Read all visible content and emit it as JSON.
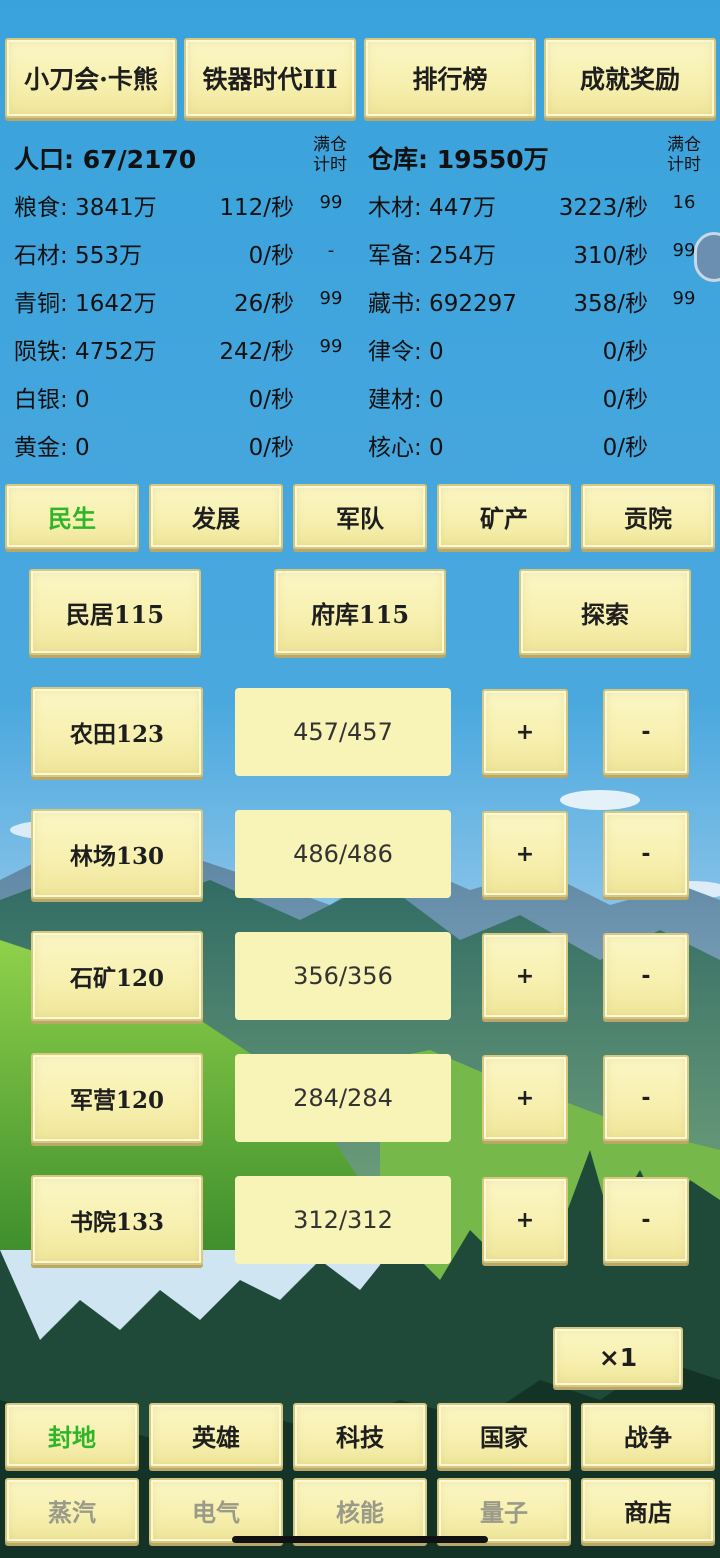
{
  "top_buttons": [
    "小刀会·卡熊",
    "铁器时代III",
    "排行榜",
    "成就奖励"
  ],
  "stats": {
    "population_label": "人口: 67/2170",
    "warehouse_label": "仓库: 19550万",
    "full_timer_label_left": "满仓\n计时",
    "full_timer_label_right": "满仓\n计时",
    "left": [
      {
        "name": "粮食: 3841万",
        "rate": "112/秒",
        "full": "99"
      },
      {
        "name": "石材: 553万",
        "rate": "0/秒",
        "full": "-"
      },
      {
        "name": "青铜: 1642万",
        "rate": "26/秒",
        "full": "99"
      },
      {
        "name": "陨铁: 4752万",
        "rate": "242/秒",
        "full": "99"
      },
      {
        "name": "白银: 0",
        "rate": "0/秒",
        "full": ""
      },
      {
        "name": "黄金: 0",
        "rate": "0/秒",
        "full": ""
      }
    ],
    "right": [
      {
        "name": "木材: 447万",
        "rate": "3223/秒",
        "full": "16"
      },
      {
        "name": "军备: 254万",
        "rate": "310/秒",
        "full": "99"
      },
      {
        "name": "藏书: 692297",
        "rate": "358/秒",
        "full": "99"
      },
      {
        "name": "律令: 0",
        "rate": "0/秒",
        "full": ""
      },
      {
        "name": "建材: 0",
        "rate": "0/秒",
        "full": ""
      },
      {
        "name": "核心: 0",
        "rate": "0/秒",
        "full": ""
      }
    ]
  },
  "tabs": [
    "民生",
    "发展",
    "军队",
    "矿产",
    "贡院"
  ],
  "buildings": [
    "民居115",
    "府库115",
    "探索"
  ],
  "workers": [
    {
      "name": "农田123",
      "count": "457/457"
    },
    {
      "name": "林场130",
      "count": "486/486"
    },
    {
      "name": "石矿120",
      "count": "356/356"
    },
    {
      "name": "军营120",
      "count": "284/284"
    },
    {
      "name": "书院133",
      "count": "312/312"
    }
  ],
  "plus_label": "+",
  "minus_label": "-",
  "speed_label": "×1",
  "nav_row1": [
    "封地",
    "英雄",
    "科技",
    "国家",
    "战争"
  ],
  "nav_row2": [
    "蒸汽",
    "电气",
    "核能",
    "量子",
    "商店"
  ],
  "colors": {
    "active_tab": "#2fb52a",
    "sky": "#3aa3dd",
    "parchment": "#f8f3b6"
  }
}
